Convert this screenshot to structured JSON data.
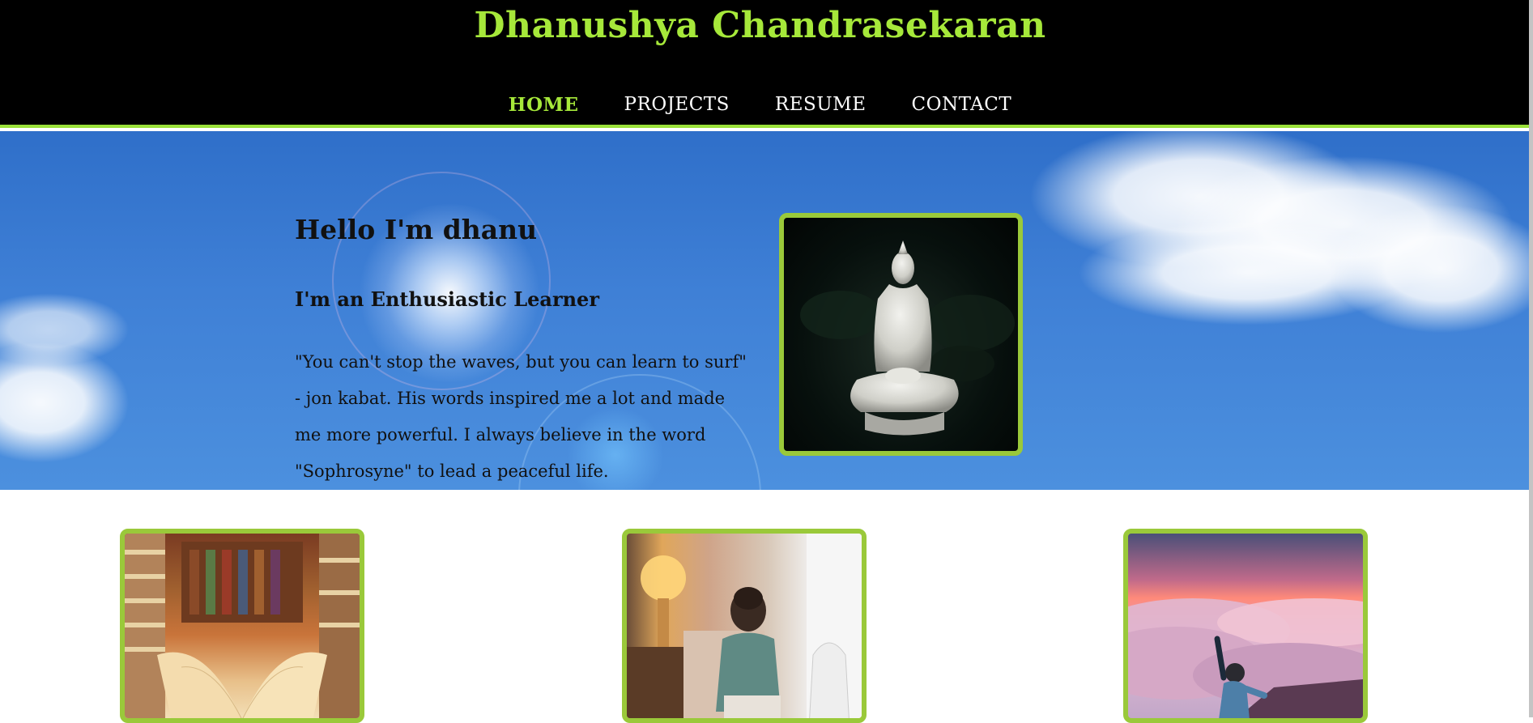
{
  "header": {
    "site_title": "Dhanushya Chandrasekaran",
    "nav": [
      "HOME",
      "PROJECTS",
      "RESUME",
      "CONTACT"
    ],
    "active_nav": "HOME"
  },
  "hero": {
    "title": "Hello I'm dhanu",
    "subtitle": "I'm an Enthusiastic Learner",
    "quote": "\"You can't stop the waves, but you can learn to surf\" - jon kabat. His words inspired me a lot and made me more powerful. I always believe in the word \"Sophrosyne\" to lead a peaceful life."
  },
  "colors": {
    "accent": "#a6e83a",
    "frame": "#9ac93a",
    "header_bg": "#000000"
  },
  "images": {
    "hero_image": "buddha-statue-image",
    "cards": [
      "open-book-library-image",
      "person-studying-at-home-image",
      "person-above-clouds-sunrise-image"
    ]
  }
}
